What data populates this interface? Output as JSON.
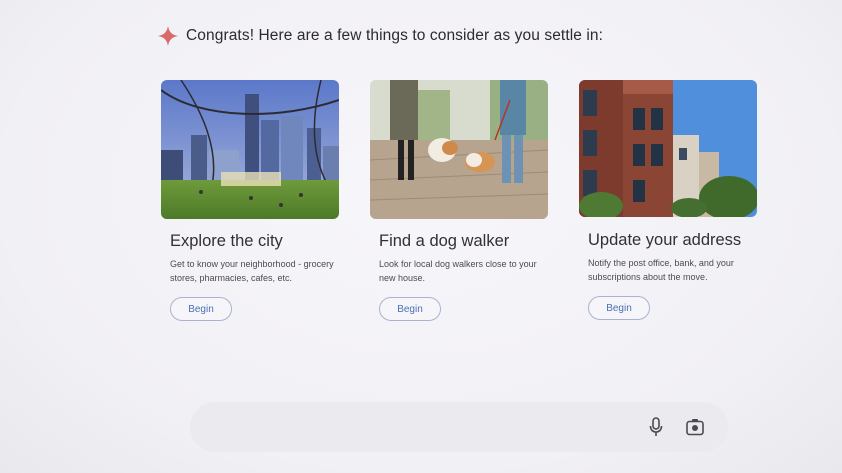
{
  "header": {
    "text": "Congrats! Here are a few things to consider as you settle in:",
    "icon": "sparkle-icon",
    "accent_color": "#d96a6a"
  },
  "cards": [
    {
      "title": "Explore the city",
      "description": "Get to know your neighborhood - grocery stores, pharmacies, cafes, etc.",
      "button_label": "Begin",
      "image": "city-skyline-photo"
    },
    {
      "title": "Find a dog walker",
      "description": "Look for local dog walkers close to your new house.",
      "button_label": "Begin",
      "image": "dog-walking-photo"
    },
    {
      "title": "Update your address",
      "description": "Notify the post office, bank, and your subscriptions about the move.",
      "button_label": "Begin",
      "image": "brick-building-photo"
    }
  ],
  "input_bar": {
    "placeholder": "",
    "icons": [
      "microphone-icon",
      "camera-icon"
    ]
  },
  "colors": {
    "button_text": "#4a6fb5",
    "button_border": "#a9b3cf",
    "background": "#f3f2f6"
  }
}
